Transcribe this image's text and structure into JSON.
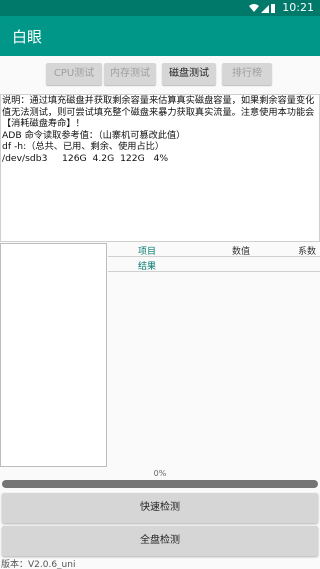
{
  "status": {
    "time": "10:21"
  },
  "app": {
    "title": "白眼"
  },
  "tabs": [
    {
      "label": "CPU测试",
      "active": false
    },
    {
      "label": "内存测试",
      "active": false
    },
    {
      "label": "磁盘测试",
      "active": true
    },
    {
      "label": "排行榜",
      "active": false
    }
  ],
  "info": {
    "lines": [
      "说明：通过填充磁盘并获取剩余容量来估算真实磁盘容量，如果剩余容量变化值无法测试，则可尝试填充整个磁盘来暴力获取真实流量。注意使用本功能会【消耗磁盘寿命】！",
      "ADB 命令读取参考值：（山寨机可篡改此值）",
      "df -h:（总共、已用、剩余、使用占比）",
      "/dev/sdb3     126G  4.2G  122G   4%"
    ]
  },
  "results": {
    "headers": {
      "item": "项目",
      "value": "数值",
      "coef": "系数"
    },
    "row_label": "结果"
  },
  "progress": {
    "label": "0%",
    "value": 0
  },
  "buttons": {
    "quick": "快速检测",
    "full": "全盘检测"
  },
  "version": "版本：V2.0.6_uni",
  "colors": {
    "primary": "#009688",
    "primary_dark": "#00796b"
  },
  "icons": [
    "wifi-icon",
    "signal-icon",
    "battery-icon"
  ]
}
